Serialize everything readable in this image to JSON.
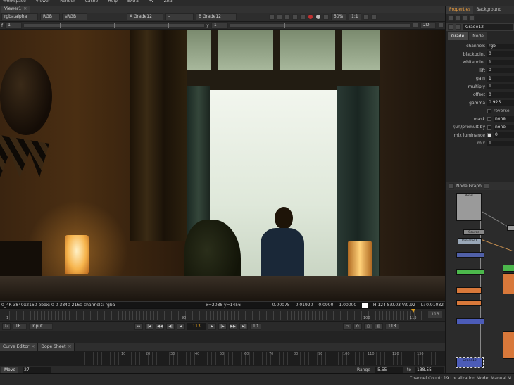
{
  "menu": [
    "Workspace",
    "Viewer",
    "Render",
    "Cache",
    "Help",
    "Extra",
    "RV",
    "Zhar"
  ],
  "viewer": {
    "tab_label": "Viewer1",
    "toolbar": {
      "channels": "rgba.alpha",
      "display_channels": "RGB",
      "colorspace": "sRGB",
      "input_a": "A  Grade12",
      "input_mid": "-",
      "input_b": "B  Grade12",
      "zoom": "50%",
      "ratio": "1:1",
      "gain_label": "f",
      "gain_value": "1",
      "gamma_label": "y",
      "gamma_value": "1",
      "view_mode": "2D"
    },
    "info": {
      "format": "0_4K 3840x2160  bbox: 0 0 3840 2160 channels: rgba",
      "coords": "x=2088 y=1456",
      "r": "0.00075",
      "g": "0.01920",
      "b": "0.0900",
      "a": "1.00000",
      "hsv": "H:124 S:0.03 V:0.92",
      "luma": "L: 0.91082"
    },
    "timeline": {
      "start": "1",
      "mid": "90",
      "mark_a": "100",
      "end_mark": "113",
      "end_frame": "113"
    },
    "transport": {
      "fps": "TF",
      "input": "Input",
      "frame": "113",
      "step": "10",
      "end": "113"
    }
  },
  "bottom": {
    "tabs": [
      "Curve Editor",
      "Dope Sheet"
    ],
    "ruler": [
      "10",
      "20",
      "30",
      "40",
      "50",
      "60",
      "70",
      "80",
      "90",
      "100",
      "110",
      "120",
      "130"
    ],
    "move_label": "Move",
    "move_value": "27",
    "range_label": "Range",
    "range_from": "-5.55",
    "range_to_label": "to",
    "range_to": "138.55"
  },
  "properties": {
    "tabs": [
      "Properties",
      "Background"
    ],
    "node_name": "Grade12",
    "subtabs": [
      "Grade",
      "Node"
    ],
    "knobs": [
      {
        "label": "channels",
        "value": "rgb"
      },
      {
        "label": "blackpoint",
        "value": "0"
      },
      {
        "label": "whitepoint",
        "value": "1"
      },
      {
        "label": "lift",
        "value": "0"
      },
      {
        "label": "gain",
        "value": "1"
      },
      {
        "label": "multiply",
        "value": "1"
      },
      {
        "label": "offset",
        "value": "0"
      },
      {
        "label": "gamma",
        "value": "0.925"
      }
    ],
    "toggles": [
      {
        "label": "",
        "value": "reverse"
      },
      {
        "label": "mask",
        "value": "none"
      },
      {
        "label": "(un)premult by",
        "value": "none"
      },
      {
        "label": "mix luminance",
        "value": "0"
      },
      {
        "label": "mix",
        "value": "1"
      }
    ]
  },
  "node_graph": {
    "title": "Node Graph",
    "nodes": [
      "Read",
      "Source",
      "Dissolve1",
      "Grade12"
    ]
  },
  "status": {
    "text": "Channel Count: 19  Localization Mode: Manual  M"
  }
}
